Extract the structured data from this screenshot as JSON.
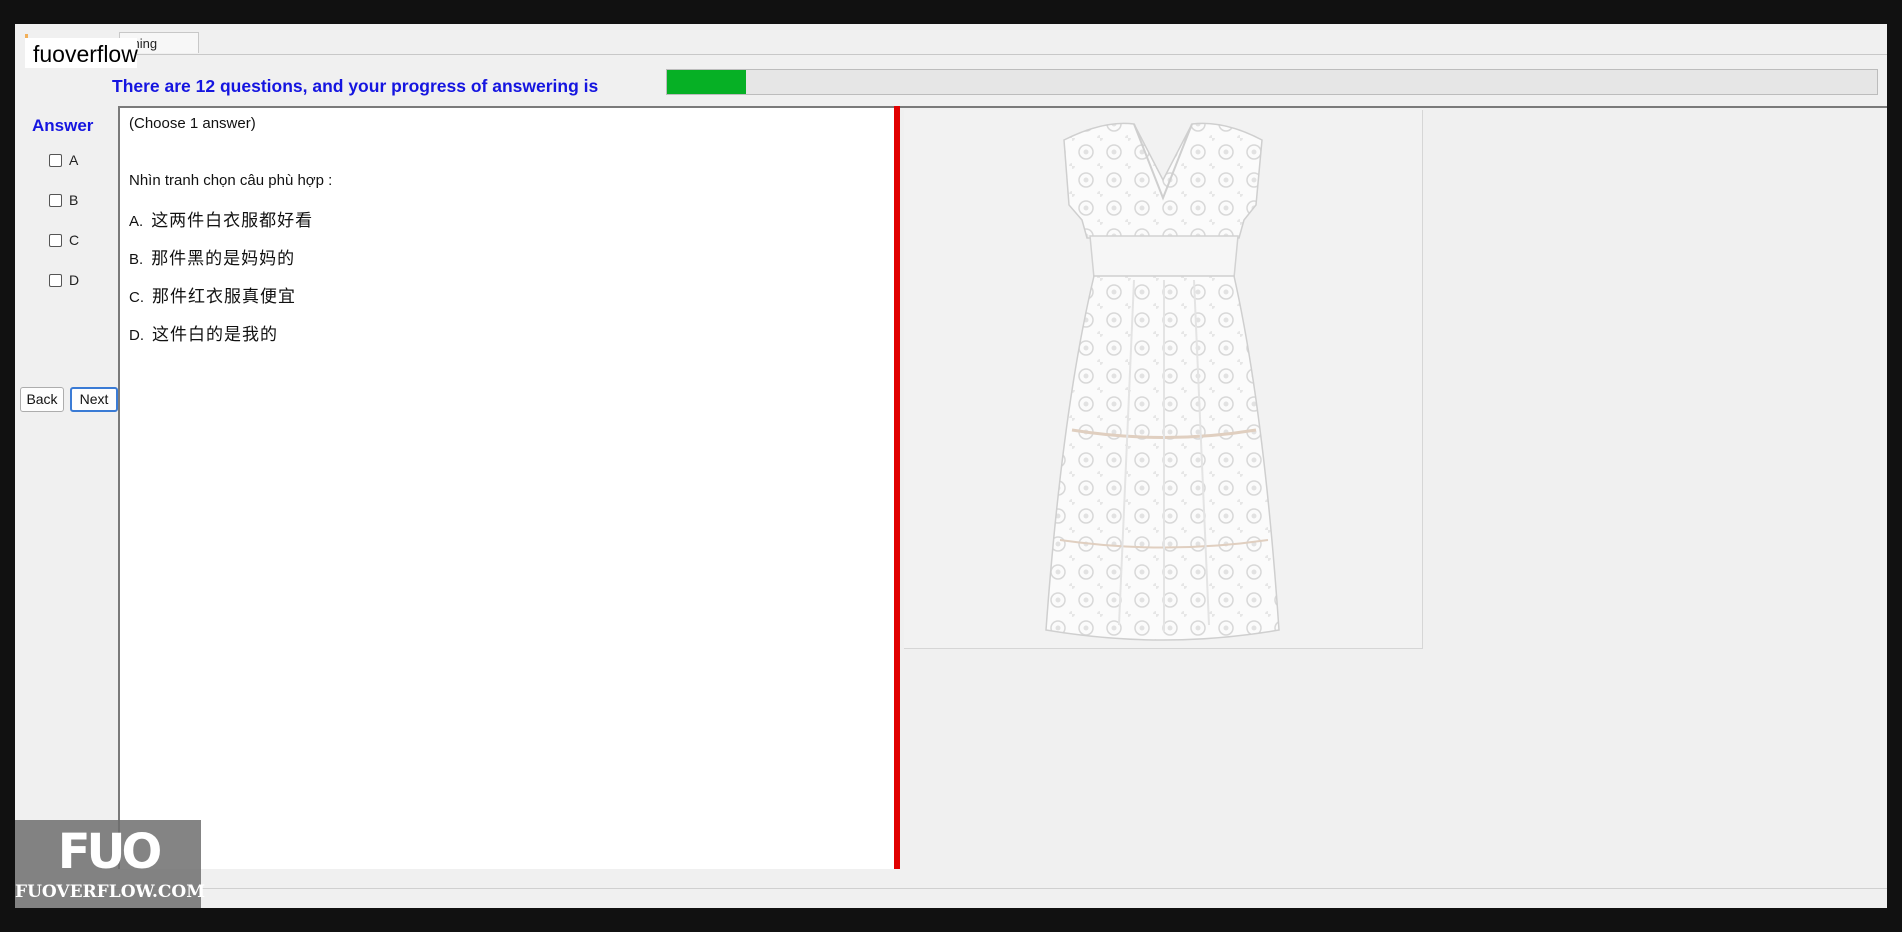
{
  "watermark_top": "fuoverflow",
  "tab": {
    "label": "ching"
  },
  "progress": {
    "text": "There are 12 questions, and your progress of answering is",
    "fraction": 0.065,
    "fill_color": "#06b025"
  },
  "answer_panel": {
    "title": "Answer",
    "options": [
      "A",
      "B",
      "C",
      "D"
    ]
  },
  "nav": {
    "back_label": "Back",
    "next_label": "Next"
  },
  "question": {
    "instruction": "(Choose 1 answer)",
    "prompt": "Nhìn tranh chọn câu phù hợp :",
    "choices": [
      {
        "letter": "A.",
        "text": "这两件白衣服都好看"
      },
      {
        "letter": "B.",
        "text": "那件黑的是妈妈的"
      },
      {
        "letter": "C.",
        "text": "那件红衣服真便宜"
      },
      {
        "letter": "D.",
        "text": "这件白的是我的"
      }
    ]
  },
  "image": {
    "subject": "white-lace-dress-photo"
  },
  "watermark_logo": {
    "mark": "FUO",
    "site": "FUOVERFLOW.COM"
  },
  "colors": {
    "accent_text": "#1515e0",
    "splitter": "#e10000"
  }
}
